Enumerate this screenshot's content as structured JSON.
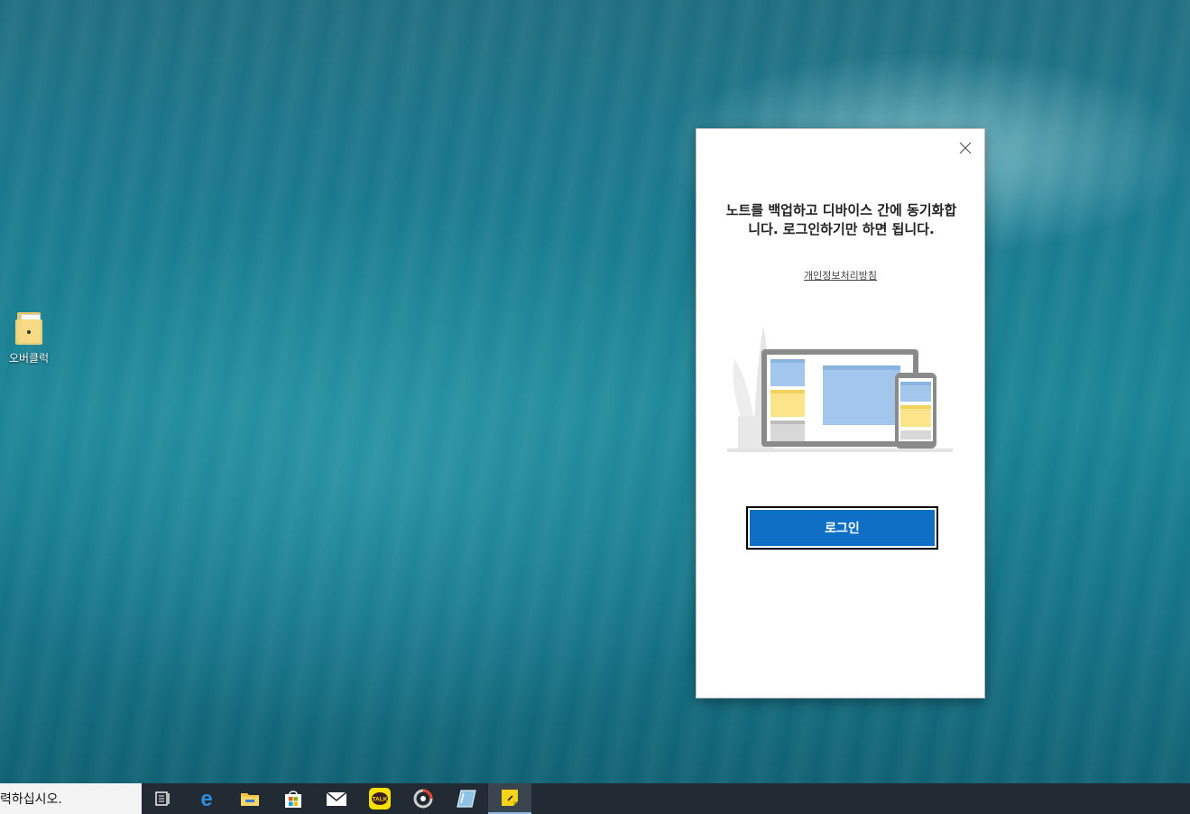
{
  "desktop": {
    "icons": [
      {
        "label": "오버클럭",
        "icon": "folder-icon"
      }
    ]
  },
  "dialog": {
    "headline": "노트를 백업하고 디바이스 간에 동기화합니다. 로그인하기만 하면 됩니다.",
    "privacy_link": "개인정보처리방침",
    "login_button": "로그인",
    "close_icon": "close-icon",
    "illustration": "devices-sync-illustration"
  },
  "taskbar": {
    "search_text": "력하십시오.",
    "apps": [
      {
        "name": "task-view-icon"
      },
      {
        "name": "edge-icon"
      },
      {
        "name": "file-explorer-icon"
      },
      {
        "name": "store-icon"
      },
      {
        "name": "mail-icon"
      },
      {
        "name": "kakaotalk-icon",
        "text": "TALK"
      },
      {
        "name": "record-app-icon"
      },
      {
        "name": "glass-app-icon"
      },
      {
        "name": "sticky-notes-icon",
        "active": true
      }
    ]
  },
  "colors": {
    "accent": "#0f6fc4",
    "taskbar": "#222b33",
    "sticky_yellow": "#f7d31a",
    "kakao_yellow": "#f9e000"
  }
}
